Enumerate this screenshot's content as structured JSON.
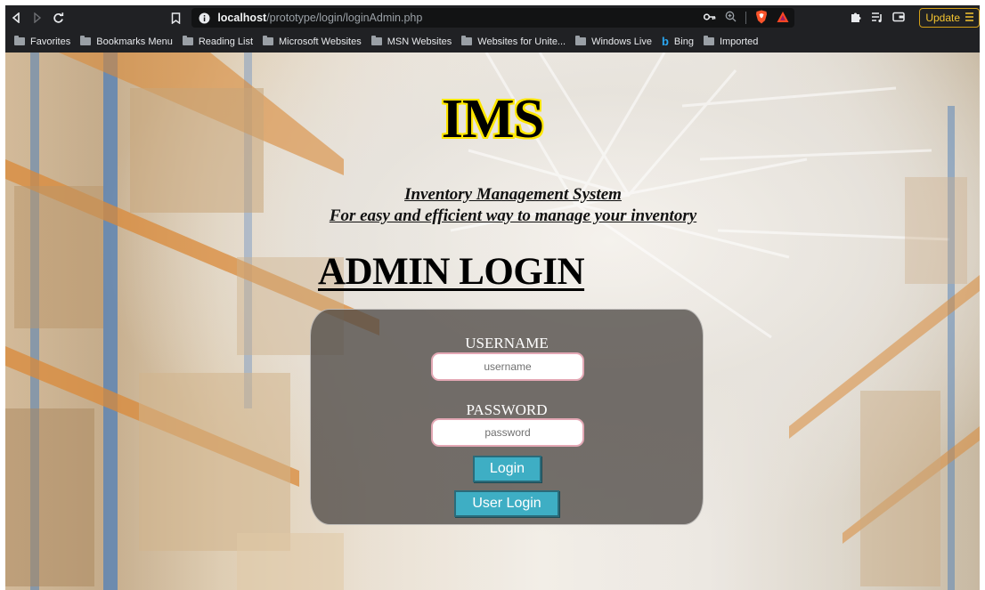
{
  "browser": {
    "url_host": "localhost",
    "url_path": "/prototype/login/loginAdmin.php",
    "update_label": "Update",
    "bookmarks": [
      {
        "label": "Favorites"
      },
      {
        "label": "Bookmarks Menu"
      },
      {
        "label": "Reading List"
      },
      {
        "label": "Microsoft Websites"
      },
      {
        "label": "MSN Websites"
      },
      {
        "label": "Websites for Unite..."
      },
      {
        "label": "Windows Live"
      },
      {
        "label": "Bing"
      },
      {
        "label": "Imported"
      }
    ]
  },
  "page": {
    "title": "IMS",
    "subtitle_line1": "Inventory Management System",
    "subtitle_line2": "For easy and efficient way to manage your inventory",
    "heading": "ADMIN LOGIN",
    "form": {
      "username_label": "USERNAME",
      "username_placeholder": "username",
      "password_label": "PASSWORD",
      "password_placeholder": "password",
      "login_button": "Login",
      "user_login_button": "User Login"
    }
  },
  "colors": {
    "title_outline": "#ffe600",
    "button_bg": "#3eaec4",
    "input_border": "#e3a7b4",
    "update_accent": "#f4c430"
  }
}
